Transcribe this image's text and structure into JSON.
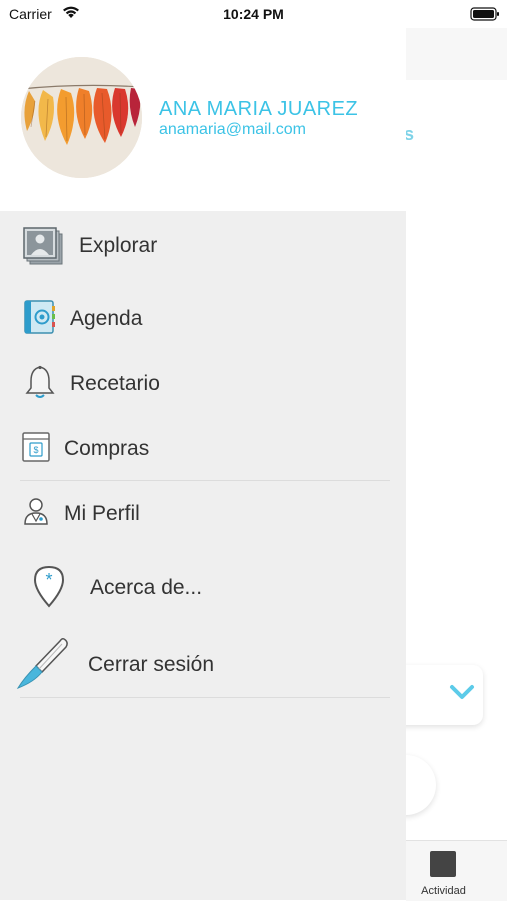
{
  "status_bar": {
    "carrier": "Carrier",
    "time": "10:24 PM"
  },
  "profile": {
    "name": "ANA MARIA JUAREZ",
    "email": "anamaria@mail.com"
  },
  "menu": {
    "items": [
      {
        "label": "Explorar",
        "icon": "photos-icon"
      },
      {
        "label": "Agenda",
        "icon": "address-book-icon"
      },
      {
        "label": "Recetario",
        "icon": "bell-icon"
      },
      {
        "label": "Compras",
        "icon": "invoice-icon"
      },
      {
        "label": "Mi Perfil",
        "icon": "doctor-icon"
      },
      {
        "label": "Acerca de...",
        "icon": "location-pin-icon"
      },
      {
        "label": "Cerrar sesión",
        "icon": "scalpel-icon"
      }
    ]
  },
  "background": {
    "partial_text": "s",
    "tab_label": "Actividad"
  },
  "colors": {
    "accent": "#3cc3e6",
    "drawer_bg": "#efefef",
    "text": "#333333"
  }
}
